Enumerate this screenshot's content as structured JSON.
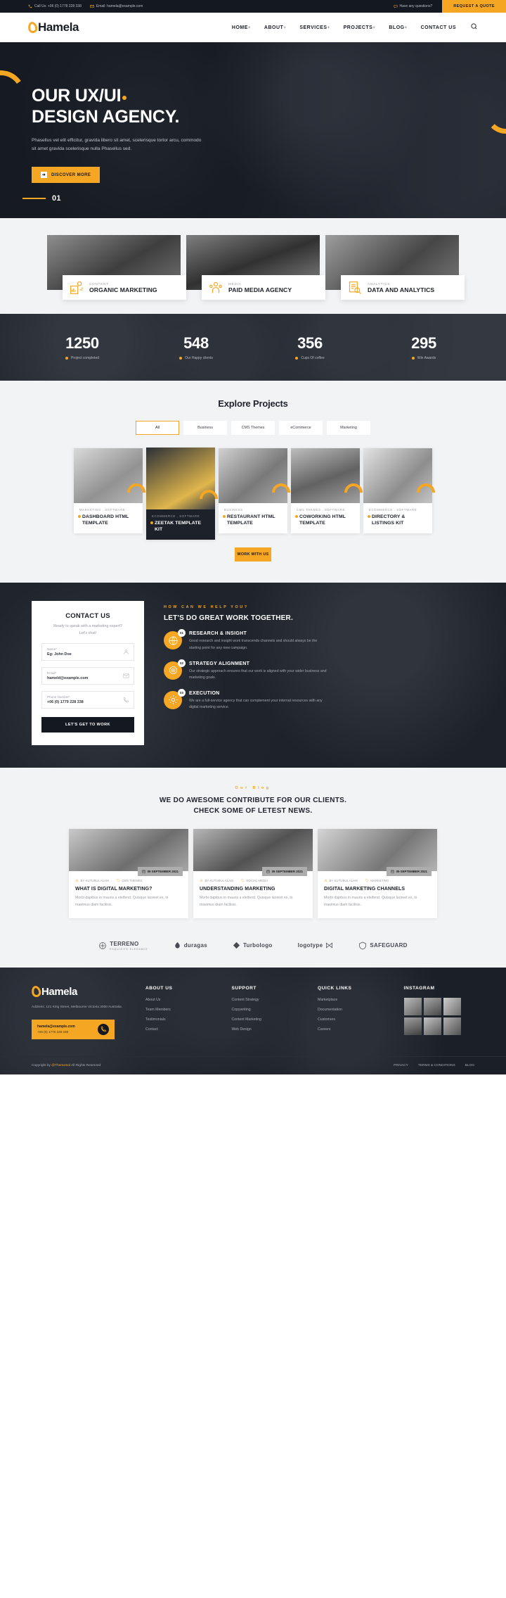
{
  "topbar": {
    "phone": "Call Us: +06 (0) 1778 228 338",
    "email": "Email: hamela@example.com",
    "question": "Have any questions?",
    "quote_label": "REQUEST A QUOTE"
  },
  "brand": {
    "name": "Hamela"
  },
  "nav": {
    "items": [
      {
        "label": "HOME",
        "caret": "+"
      },
      {
        "label": "ABOUT",
        "caret": "+"
      },
      {
        "label": "SERVICES",
        "caret": "+"
      },
      {
        "label": "PROJECTS",
        "caret": "+"
      },
      {
        "label": "BLOG",
        "caret": "+"
      },
      {
        "label": "CONTACT US",
        "caret": ""
      }
    ]
  },
  "hero": {
    "line1": "OUR UX/UI",
    "line2": "DESIGN AGENCY.",
    "paragraph": "Phasellus vel elit efficitur, gravida libero sit amet, scelerisque tortor arcu, commodo sit amet gravida scelerisque nulla Phasellus sed.",
    "cta": "DISCOVER MORE",
    "slide_number": "01"
  },
  "services": [
    {
      "sub": "CONTENT",
      "title": "ORGANIC MARKETING",
      "icon": "content-chart-icon"
    },
    {
      "sub": "MEDIA",
      "title": "PAID MEDIA AGENCY",
      "icon": "media-people-icon"
    },
    {
      "sub": "ANALYTICS",
      "title": "DATA AND ANALYTICS",
      "icon": "analytics-search-icon"
    }
  ],
  "stats": [
    {
      "number": "1250",
      "label": "Project completed"
    },
    {
      "number": "548",
      "label": "Our Happy clients"
    },
    {
      "number": "356",
      "label": "Cups Of coffee"
    },
    {
      "number": "295",
      "label": "Win Awards"
    }
  ],
  "projects": {
    "title": "Explore Projects",
    "filters": [
      "All",
      "Business",
      "CMS Themes",
      "eCommerce",
      "Marketing"
    ],
    "active_filter": "All",
    "cards": [
      {
        "cat": "MARKETING , SOFTWARE",
        "title": "DASHBOARD HTML TEMPLATE"
      },
      {
        "cat": "ECOMMERCE , SOFTWARE",
        "title": "ZEETAK TEMPLATE KIT"
      },
      {
        "cat": "BUSINESS",
        "title": "RESTAURANT HTML TEMPLATE"
      },
      {
        "cat": "CMS THEMES , SOFTWARE",
        "title": "COWORKING HTML TEMPLATE"
      },
      {
        "cat": "ECOMMERCE , SOFTWARE",
        "title": "DIRECTORY & LISTINGS KIT"
      }
    ],
    "more_button": "WORK WITH US"
  },
  "contact": {
    "heading": "CONTACT US",
    "sub1": "Ready to speak with a marketing expert?",
    "sub2": "Let's chat!",
    "fields": [
      {
        "label": "Name*",
        "value": "Eg: John Doe",
        "icon": "user-icon"
      },
      {
        "label": "Email*",
        "value": "hameld@example.com",
        "icon": "mail-icon"
      },
      {
        "label": "Phone Number*",
        "value": "+06 (0) 1779 228 338",
        "icon": "phone-icon"
      }
    ],
    "submit": "LET'S GET TO WORK",
    "kicker": "HOW CAN WE HELP YOU?",
    "title": "LET'S DO GREAT WORK TOGETHER.",
    "steps": [
      {
        "num": "01",
        "title": "RESEARCH & INSIGHT",
        "desc": "Good research and insight work transcends channels and should always be the starting point for any new campaign.",
        "icon": "globe-research-icon"
      },
      {
        "num": "02",
        "title": "STRATEGY ALIGNMENT",
        "desc": "Our strategic approach ensures that our work is aligned with your wider business and marketing goals.",
        "icon": "strategy-target-icon"
      },
      {
        "num": "03",
        "title": "EXECUTION",
        "desc": "We are a full-service agency that can complement your internal resources with any digital marketing service.",
        "icon": "execution-gear-icon"
      }
    ]
  },
  "blog": {
    "kicker": "Our Blog",
    "headline1": "WE DO AWESOME CONTRIBUTE FOR OUR CLIENTS.",
    "headline2": "CHECK SOME OF LETEST NEWS.",
    "posts": [
      {
        "date": "09 SEPTEMBER 2021",
        "author": "BY KUTUBUL ALAM",
        "cat": "CMS THEMES",
        "title": "WHAT IS DIGITAL MARKETING?",
        "excerpt": "Morbi dapibus in mauris a eleifend. Quisque laoreet ex, in maximus diam facilisis."
      },
      {
        "date": "09 SEPTEMBER 2021",
        "author": "BY KUTUBUL ALAM",
        "cat": "SOCIAL MEDIA",
        "title": "UNDERSTANDING MARKETING",
        "excerpt": "Morbi dapibus in mauris a eleifend. Quisque laoreet ex, in maximus diam facilisis."
      },
      {
        "date": "09 SEPTEMBER 2021",
        "author": "BY KUTUBUL ALAM",
        "cat": "MARKETING",
        "title": "DIGITAL MARKETING CHANNELS",
        "excerpt": "Morbi dapibus in mauris a eleifend. Quisque laoreet ex, in maximus diam facilisis."
      }
    ]
  },
  "brands": [
    {
      "name": "TERRENO",
      "sub": "EXQUISITE ELEGANCE"
    },
    {
      "name": "duragas",
      "sub": ""
    },
    {
      "name": "Turbologo",
      "sub": ""
    },
    {
      "name": "logotype",
      "sub": ""
    },
    {
      "name": "SAFEGUARD",
      "sub": ""
    }
  ],
  "footer": {
    "address": "Address: 121 King Street, Melbourne Victoria 3000 Australia.",
    "cta_mail": "hamela@example.com",
    "cta_phone": "+06 (0) 1778 228 338",
    "columns": [
      {
        "heading": "ABOUT US",
        "items": [
          "About Us",
          "Team Members",
          "Testimonials",
          "Contact"
        ]
      },
      {
        "heading": "SUPPORT",
        "items": [
          "Content Strategy",
          "Copywriting",
          "Content Marketing",
          "Web Design"
        ]
      },
      {
        "heading": "QUICK LINKS",
        "items": [
          "Marketplace",
          "Documentation",
          "Customers",
          "Careers"
        ]
      }
    ],
    "instagram_heading": "INSTAGRAM",
    "copyright_pre": "Copyright by",
    "copyright_brand": "@ThemeSol",
    "copyright_post": "All Rights Reserved",
    "bottom_links": [
      "PRIVACY",
      "TERMS & CONDITIONS",
      "BLOG"
    ]
  }
}
